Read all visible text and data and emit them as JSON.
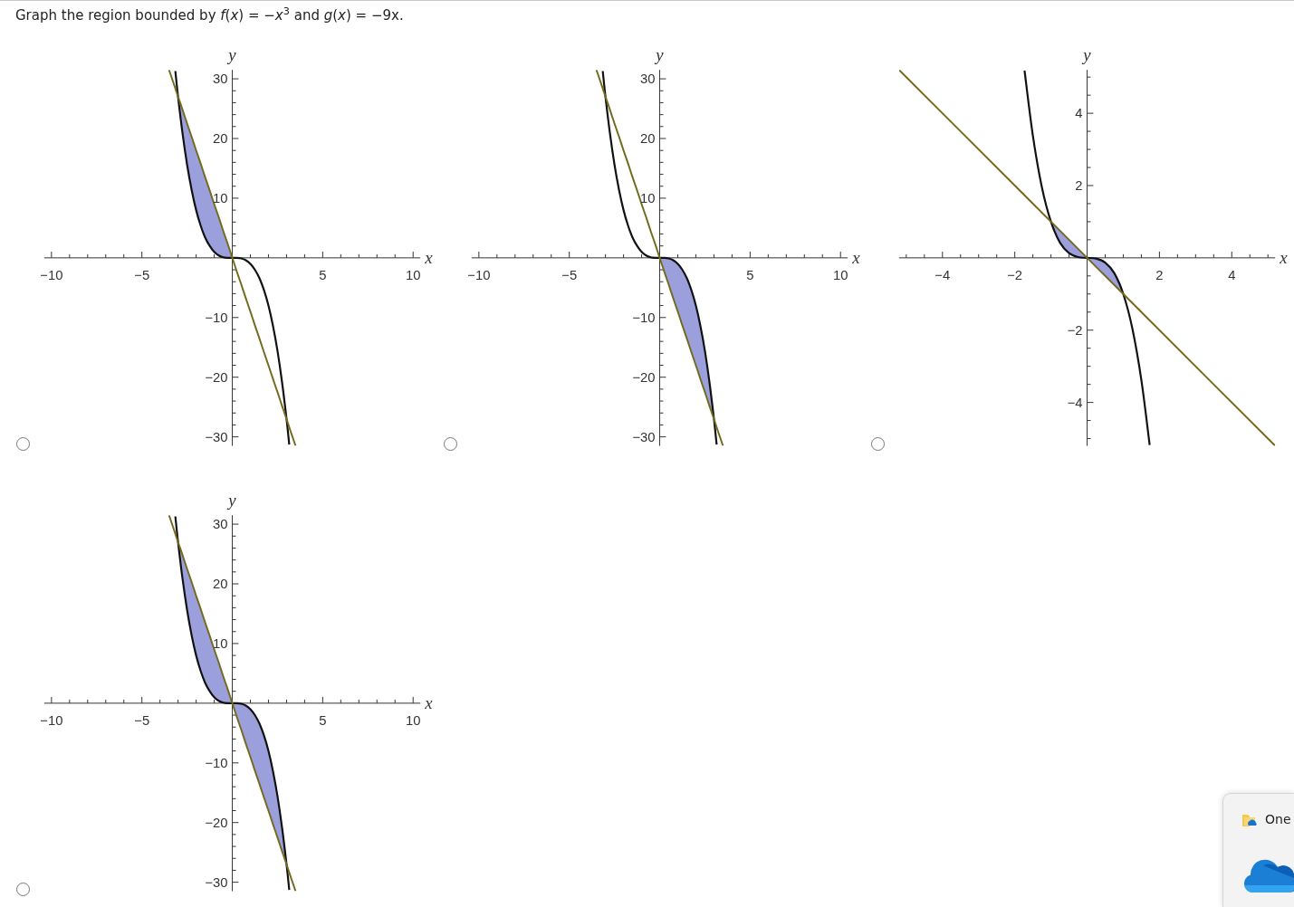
{
  "question": "Graph the region bounded by *f*(*x*) = −*x*$^{3}$ and *g*(*x*) = −9x.",
  "options": [
    {
      "selected": false,
      "shaded_left": true,
      "shaded_right": false,
      "chart_data": {
        "type": "line",
        "xlabel": "x",
        "ylabel": "y",
        "xlim": [
          -10.4,
          10.4
        ],
        "ylim": [
          -31.5,
          31.5
        ],
        "xticks": [
          {
            "value": -10,
            "label": "−10"
          },
          {
            "value": -5,
            "label": "−5"
          },
          {
            "value": 5,
            "label": "5"
          },
          {
            "value": 10,
            "label": "10"
          }
        ],
        "yticks": [
          {
            "value": -30,
            "label": "−30"
          },
          {
            "value": -20,
            "label": "−20"
          },
          {
            "value": -10,
            "label": "−10"
          },
          {
            "value": 10,
            "label": "10"
          },
          {
            "value": 20,
            "label": "20"
          },
          {
            "value": 30,
            "label": "30"
          }
        ],
        "x": [
          -3.5,
          -3.15,
          -3,
          -2.75,
          -2.5,
          -2.25,
          -2,
          -1.75,
          -1.5,
          -1.25,
          -1,
          -0.75,
          -0.5,
          -0.25,
          0,
          0.25,
          0.5,
          0.75,
          1,
          1.25,
          1.5,
          1.75,
          2,
          2.25,
          2.5,
          2.75,
          3,
          3.15,
          3.5
        ],
        "series": [
          {
            "color": "#111111",
            "values": [
              null,
              31.3,
              27,
              20.8,
              15.6,
              11.4,
              8,
              5.4,
              3.4,
              2,
              1,
              0.4,
              0.1,
              0,
              0,
              0,
              -0.1,
              -0.4,
              -1,
              -2,
              -3.4,
              -5.4,
              -8,
              -11.4,
              -15.6,
              -20.8,
              -27,
              -31.3,
              null
            ]
          },
          {
            "color": "#736b1f",
            "values": [
              31.5,
              28.4,
              27,
              24.8,
              22.5,
              20.3,
              18,
              15.8,
              13.5,
              11.3,
              9,
              6.8,
              4.5,
              2.3,
              0,
              -2.3,
              -4.5,
              -6.8,
              -9,
              -11.3,
              -13.5,
              -15.8,
              -18,
              -20.3,
              -22.5,
              -24.8,
              -27,
              -28.4,
              -31.5
            ]
          }
        ]
      }
    },
    {
      "selected": false,
      "shaded_left": false,
      "shaded_right": true,
      "chart_data": {
        "type": "line",
        "xlabel": "x",
        "ylabel": "y",
        "xlim": [
          -10.4,
          10.4
        ],
        "ylim": [
          -31.5,
          31.5
        ],
        "xticks": [
          {
            "value": -10,
            "label": "−10"
          },
          {
            "value": -5,
            "label": "−5"
          },
          {
            "value": 5,
            "label": "5"
          },
          {
            "value": 10,
            "label": "10"
          }
        ],
        "yticks": [
          {
            "value": -30,
            "label": "−30"
          },
          {
            "value": -20,
            "label": "−20"
          },
          {
            "value": -10,
            "label": "−10"
          },
          {
            "value": 10,
            "label": "10"
          },
          {
            "value": 20,
            "label": "20"
          },
          {
            "value": 30,
            "label": "30"
          }
        ],
        "x": [
          -3.5,
          -3.15,
          -3,
          -2.75,
          -2.5,
          -2.25,
          -2,
          -1.75,
          -1.5,
          -1.25,
          -1,
          -0.75,
          -0.5,
          -0.25,
          0,
          0.25,
          0.5,
          0.75,
          1,
          1.25,
          1.5,
          1.75,
          2,
          2.25,
          2.5,
          2.75,
          3,
          3.15,
          3.5
        ],
        "series": [
          {
            "color": "#111111",
            "values": [
              null,
              31.3,
              27,
              20.8,
              15.6,
              11.4,
              8,
              5.4,
              3.4,
              2,
              1,
              0.4,
              0.1,
              0,
              0,
              0,
              -0.1,
              -0.4,
              -1,
              -2,
              -3.4,
              -5.4,
              -8,
              -11.4,
              -15.6,
              -20.8,
              -27,
              -31.3,
              null
            ]
          },
          {
            "color": "#736b1f",
            "values": [
              31.5,
              28.4,
              27,
              24.8,
              22.5,
              20.3,
              18,
              15.8,
              13.5,
              11.3,
              9,
              6.8,
              4.5,
              2.3,
              0,
              -2.3,
              -4.5,
              -6.8,
              -9,
              -11.3,
              -13.5,
              -15.8,
              -18,
              -20.3,
              -22.5,
              -24.8,
              -27,
              -28.4,
              -31.5
            ]
          }
        ]
      }
    },
    {
      "selected": false,
      "shaded_left": true,
      "shaded_right": true,
      "chart_data": {
        "type": "line",
        "xlabel": "x",
        "ylabel": "y",
        "xlim": [
          -5.2,
          5.2
        ],
        "ylim": [
          -5.2,
          5.2
        ],
        "xticks": [
          {
            "value": -4,
            "label": "−4"
          },
          {
            "value": -2,
            "label": "−2"
          },
          {
            "value": 2,
            "label": "2"
          },
          {
            "value": 4,
            "label": "4"
          }
        ],
        "yticks": [
          {
            "value": -4,
            "label": "−4"
          },
          {
            "value": -2,
            "label": "−2"
          },
          {
            "value": 2,
            "label": "2"
          },
          {
            "value": 4,
            "label": "4"
          }
        ],
        "x": [
          -5.2,
          -1.73,
          -1.5,
          -1.25,
          -1,
          -0.75,
          -0.5,
          -0.25,
          0,
          0.25,
          0.5,
          0.75,
          1,
          1.25,
          1.5,
          1.73,
          5.2
        ],
        "series": [
          {
            "color": "#111111",
            "values": [
              null,
              5.18,
              3.38,
              1.95,
              1,
              0.42,
              0.13,
              0.02,
              0,
              -0.02,
              -0.13,
              -0.42,
              -1,
              -1.95,
              -3.38,
              -5.18,
              null
            ]
          },
          {
            "color": "#736b1f",
            "values": [
              5.2,
              1.73,
              1.5,
              1.25,
              1,
              0.75,
              0.5,
              0.25,
              0,
              -0.25,
              -0.5,
              -0.75,
              -1,
              -1.25,
              -1.5,
              -1.73,
              -5.2
            ]
          }
        ]
      }
    },
    {
      "selected": false,
      "shaded_left": true,
      "shaded_right": true,
      "chart_data": {
        "type": "line",
        "xlabel": "x",
        "ylabel": "y",
        "xlim": [
          -10.4,
          10.4
        ],
        "ylim": [
          -31.5,
          31.5
        ],
        "xticks": [
          {
            "value": -10,
            "label": "−10"
          },
          {
            "value": -5,
            "label": "−5"
          },
          {
            "value": 5,
            "label": "5"
          },
          {
            "value": 10,
            "label": "10"
          }
        ],
        "yticks": [
          {
            "value": -30,
            "label": "−30"
          },
          {
            "value": -20,
            "label": "−20"
          },
          {
            "value": -10,
            "label": "−10"
          },
          {
            "value": 10,
            "label": "10"
          },
          {
            "value": 20,
            "label": "20"
          },
          {
            "value": 30,
            "label": "30"
          }
        ],
        "x": [
          -3.5,
          -3.15,
          -3,
          -2.75,
          -2.5,
          -2.25,
          -2,
          -1.75,
          -1.5,
          -1.25,
          -1,
          -0.75,
          -0.5,
          -0.25,
          0,
          0.25,
          0.5,
          0.75,
          1,
          1.25,
          1.5,
          1.75,
          2,
          2.25,
          2.5,
          2.75,
          3,
          3.15,
          3.5
        ],
        "series": [
          {
            "color": "#111111",
            "values": [
              null,
              31.3,
              27,
              20.8,
              15.6,
              11.4,
              8,
              5.4,
              3.4,
              2,
              1,
              0.4,
              0.1,
              0,
              0,
              0,
              -0.1,
              -0.4,
              -1,
              -2,
              -3.4,
              -5.4,
              -8,
              -11.4,
              -15.6,
              -20.8,
              -27,
              -31.3,
              null
            ]
          },
          {
            "color": "#736b1f",
            "values": [
              31.5,
              28.4,
              27,
              24.8,
              22.5,
              20.3,
              18,
              15.8,
              13.5,
              11.3,
              9,
              6.8,
              4.5,
              2.3,
              0,
              -2.3,
              -4.5,
              -6.8,
              -9,
              -11.3,
              -13.5,
              -15.8,
              -18,
              -20.3,
              -22.5,
              -24.8,
              -27,
              -28.4,
              -31.5
            ]
          }
        ]
      }
    }
  ],
  "notification": {
    "title": "One"
  }
}
